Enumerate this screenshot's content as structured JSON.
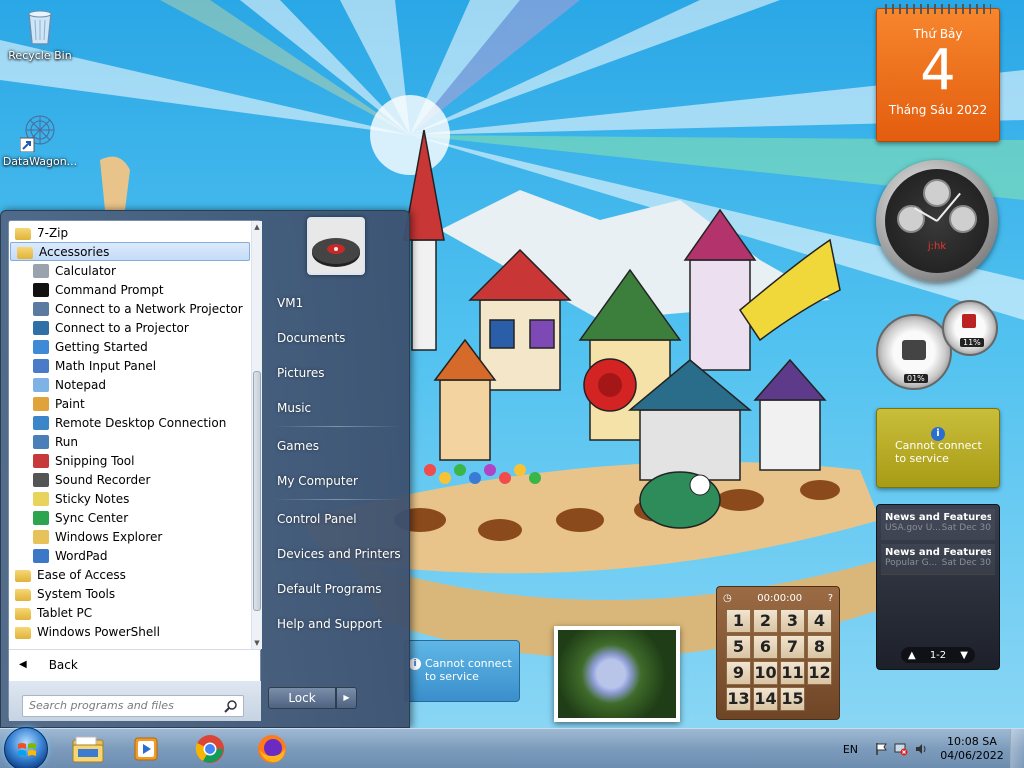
{
  "desktop": {
    "icons": [
      {
        "label": "Recycle Bin"
      },
      {
        "label": "DataWagon..."
      }
    ]
  },
  "gadgets": {
    "calendar": {
      "weekday": "Thứ Bảy",
      "day": "4",
      "month_year": "Tháng Sáu 2022"
    },
    "clock": {
      "brand": "j:hk"
    },
    "cpu_meter": {
      "cpu": "01%",
      "memory": "11%"
    },
    "weather_1": {
      "message": "Cannot connect to service"
    },
    "weather_2": {
      "message": "Cannot connect to service"
    },
    "news": {
      "items": [
        {
          "headline": "News and Features f...",
          "source": "USA.gov U...",
          "date": "Sat Dec 30"
        },
        {
          "headline": "News and Features f...",
          "source": "Popular G...",
          "date": "Sat Dec 30"
        }
      ],
      "pager": "1-2"
    },
    "puzzle": {
      "timer": "00:00:00",
      "tiles": [
        "1",
        "2",
        "3",
        "4",
        "5",
        "6",
        "7",
        "8",
        "9",
        "10",
        "11",
        "12",
        "13",
        "14",
        "15",
        ""
      ]
    }
  },
  "start_menu": {
    "programs": [
      {
        "label": "7-Zip",
        "type": "folder"
      },
      {
        "label": "Accessories",
        "type": "folder",
        "selected": true
      },
      {
        "label": "Calculator",
        "type": "app",
        "icon": "calculator-icon"
      },
      {
        "label": "Command Prompt",
        "type": "app",
        "icon": "command-prompt-icon"
      },
      {
        "label": "Connect to a Network Projector",
        "type": "app",
        "icon": "network-projector-icon"
      },
      {
        "label": "Connect to a Projector",
        "type": "app",
        "icon": "projector-icon"
      },
      {
        "label": "Getting Started",
        "type": "app",
        "icon": "getting-started-icon"
      },
      {
        "label": "Math Input Panel",
        "type": "app",
        "icon": "math-input-icon"
      },
      {
        "label": "Notepad",
        "type": "app",
        "icon": "notepad-icon"
      },
      {
        "label": "Paint",
        "type": "app",
        "icon": "paint-icon"
      },
      {
        "label": "Remote Desktop Connection",
        "type": "app",
        "icon": "remote-desktop-icon"
      },
      {
        "label": "Run",
        "type": "app",
        "icon": "run-icon"
      },
      {
        "label": "Snipping Tool",
        "type": "app",
        "icon": "snipping-tool-icon"
      },
      {
        "label": "Sound Recorder",
        "type": "app",
        "icon": "microphone-icon"
      },
      {
        "label": "Sticky Notes",
        "type": "app",
        "icon": "sticky-notes-icon"
      },
      {
        "label": "Sync Center",
        "type": "app",
        "icon": "sync-center-icon"
      },
      {
        "label": "Windows Explorer",
        "type": "app",
        "icon": "windows-explorer-icon"
      },
      {
        "label": "WordPad",
        "type": "app",
        "icon": "wordpad-icon"
      },
      {
        "label": "Ease of Access",
        "type": "folder"
      },
      {
        "label": "System Tools",
        "type": "folder"
      },
      {
        "label": "Tablet PC",
        "type": "folder"
      },
      {
        "label": "Windows PowerShell",
        "type": "folder"
      }
    ],
    "back_label": "Back",
    "search_placeholder": "Search programs and files",
    "right_links": [
      {
        "label": "VM1"
      },
      {
        "label": "Documents"
      },
      {
        "label": "Pictures"
      },
      {
        "label": "Music"
      },
      {
        "label": "Games"
      },
      {
        "label": "My Computer"
      },
      {
        "label": "Control Panel"
      },
      {
        "label": "Devices and Printers"
      },
      {
        "label": "Default Programs"
      },
      {
        "label": "Help and Support"
      }
    ],
    "lock_label": "Lock"
  },
  "taskbar": {
    "pinned": [
      "file-explorer-icon",
      "media-player-icon",
      "chrome-icon",
      "firefox-icon"
    ],
    "tray": {
      "language": "EN",
      "time": "10:08 SA",
      "date": "04/06/2022"
    }
  }
}
